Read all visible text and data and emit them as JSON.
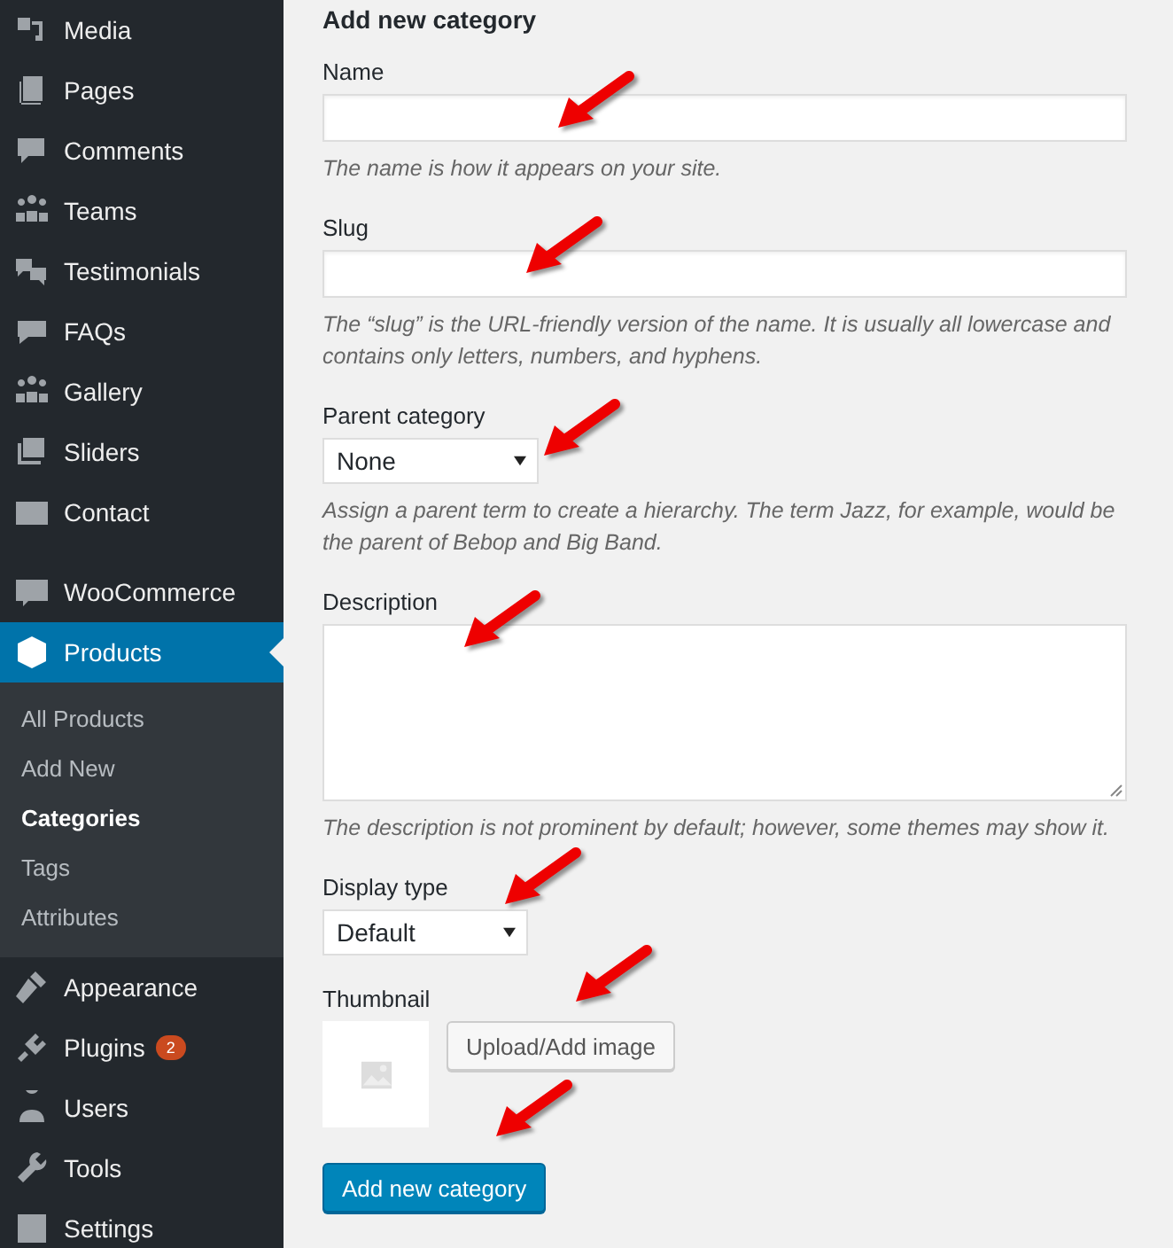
{
  "sidebar": {
    "groups": [
      [
        {
          "label": "Media",
          "selected": false
        },
        {
          "label": "Pages",
          "selected": false
        },
        {
          "label": "Comments",
          "selected": false
        },
        {
          "label": "Teams",
          "selected": false
        },
        {
          "label": "Testimonials",
          "selected": false
        },
        {
          "label": "FAQs",
          "selected": false
        },
        {
          "label": "Gallery",
          "selected": false
        },
        {
          "label": "Sliders",
          "selected": false
        },
        {
          "label": "Contact",
          "selected": false
        }
      ],
      [
        {
          "label": "WooCommerce",
          "selected": false
        },
        {
          "label": "Products",
          "selected": true,
          "children": [
            {
              "label": "All Products",
              "selected": false
            },
            {
              "label": "Add New",
              "selected": false
            },
            {
              "label": "Categories",
              "selected": true
            },
            {
              "label": "Tags",
              "selected": false
            },
            {
              "label": "Attributes",
              "selected": false
            }
          ]
        },
        {
          "label": "Appearance",
          "selected": false
        },
        {
          "label": "Plugins",
          "selected": false,
          "badge": "2"
        },
        {
          "label": "Users",
          "selected": false
        },
        {
          "label": "Tools",
          "selected": false
        },
        {
          "label": "Settings",
          "selected": false
        }
      ]
    ]
  },
  "form": {
    "heading": "Add new category",
    "fields": [
      {
        "kind": "text",
        "label": "Name",
        "description": "The name is how it appears on your site."
      },
      {
        "kind": "text",
        "label": "Slug",
        "description": "The “slug” is the URL-friendly version of the name. It is usually all lowercase and contains only letters, numbers, and hyphens."
      },
      {
        "kind": "select",
        "label": "Parent category",
        "value": "None",
        "description": "Assign a parent term to create a hierarchy. The term Jazz, for example, would be the parent of Bebop and Big Band."
      },
      {
        "kind": "textarea",
        "label": "Description",
        "description": "The description is not prominent by default; however, some themes may show it."
      },
      {
        "kind": "select",
        "label": "Display type",
        "value": "Default"
      },
      {
        "kind": "thumbnail",
        "label": "Thumbnail",
        "button": "Upload/Add image"
      }
    ],
    "submit": "Add new category"
  }
}
